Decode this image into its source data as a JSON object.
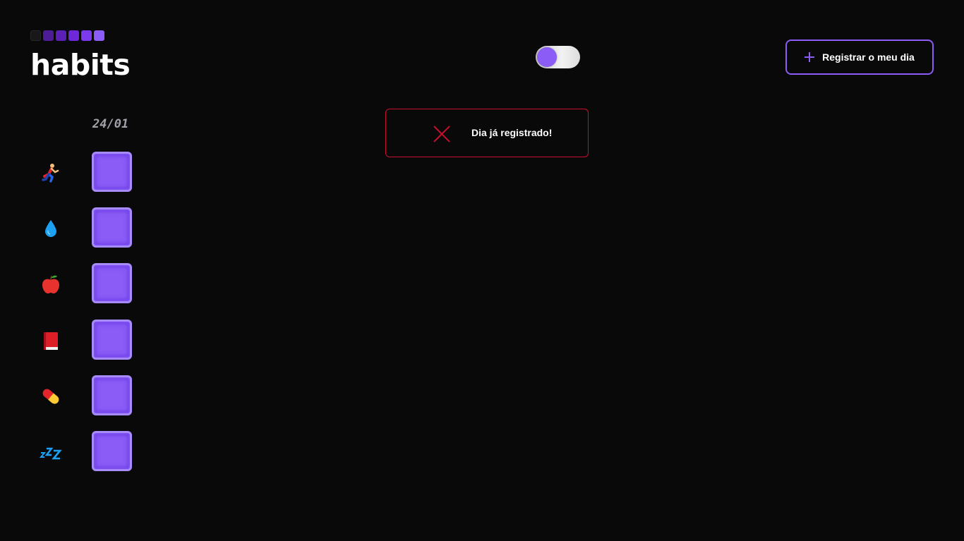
{
  "app": {
    "logo_text": "habits",
    "logo_squares": [
      "#27272a",
      "#4c1d95",
      "#5b21b6",
      "#6d28d9",
      "#7c3aed",
      "#8b5cf6"
    ]
  },
  "header": {
    "theme_toggle": {
      "state": "off"
    },
    "register_button": {
      "label": "Registrar o meu dia",
      "icon": "plus-icon"
    }
  },
  "toast": {
    "message": "Dia já registrado!",
    "icon": "close-icon",
    "color": "#c8102e"
  },
  "table": {
    "date": "24/01",
    "habits": [
      {
        "icon": "running-icon",
        "emoji": "🏃",
        "checked": false
      },
      {
        "icon": "water-drop-icon",
        "emoji": "💧",
        "checked": false
      },
      {
        "icon": "apple-icon",
        "emoji": "🍎",
        "checked": false
      },
      {
        "icon": "book-icon",
        "emoji": "📕",
        "checked": false
      },
      {
        "icon": "pill-icon",
        "emoji": "💊",
        "checked": false
      },
      {
        "icon": "sleep-icon",
        "emoji": "💤",
        "checked": false
      }
    ]
  },
  "colors": {
    "background": "#09090a",
    "accent": "#8b5cf6",
    "error": "#c8102e"
  }
}
